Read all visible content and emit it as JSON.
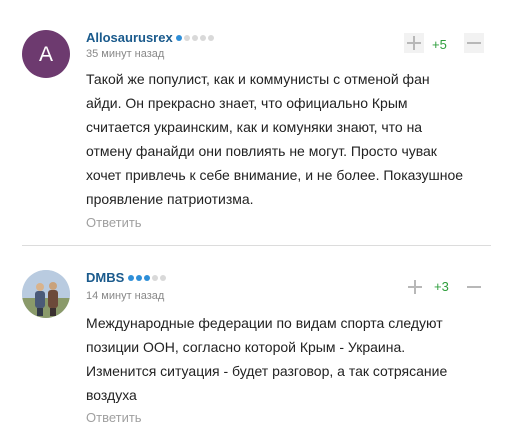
{
  "comments": [
    {
      "avatar_letter": "A",
      "author": "Allosaurusrex",
      "rating_dots": 1,
      "rating_total": 5,
      "time": "35 минут назад",
      "score": "+5",
      "lines": [
        "Такой же популист, как и коммунисты с отменой фан",
        "айди. Он прекрасно знает, что официально Крым",
        "считается украинским, как и комуняки знают, что на",
        "отмену фанайди они повлиять не могут. Просто чувак",
        "хочет привлечь к себе внимание, и не более. Показушное",
        "проявление патриотизма."
      ],
      "reply": "Ответить"
    },
    {
      "author": "DMBS",
      "rating_dots": 3,
      "rating_total": 5,
      "time": "14 минут назад",
      "score": "+3",
      "lines": [
        "Международные федерации по видам спорта следуют",
        "позиции ООН, согласно которой Крым - Украина.",
        "Изменится ситуация - будет разговор, а так сотрясание",
        "воздуха"
      ],
      "reply": "Ответить"
    }
  ],
  "colors": {
    "author": "#1a5a8c",
    "score": "#2e9e3c",
    "rating_on": "#2f8fd8",
    "rating_off": "#d9d9d9",
    "avatar_bg": "#6d3a6f"
  }
}
